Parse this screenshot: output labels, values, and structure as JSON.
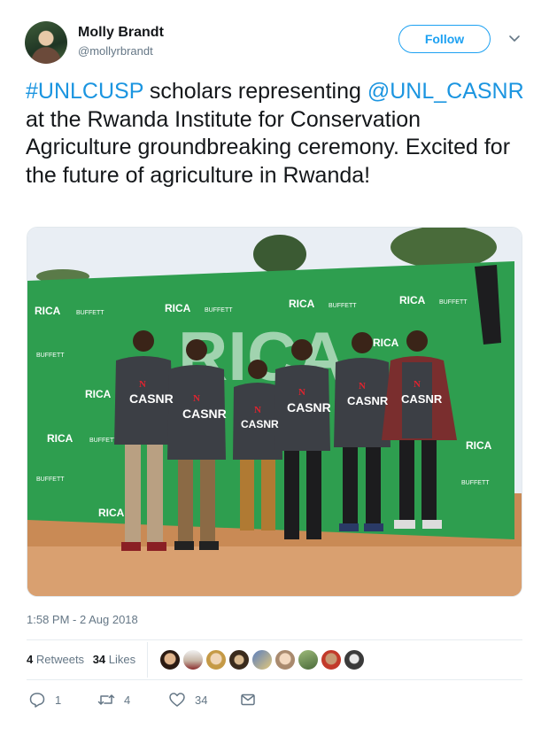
{
  "user": {
    "name": "Molly Brandt",
    "handle": "@mollyrbrandt",
    "follow_label": "Follow"
  },
  "tweet": {
    "hashtag": "#UNLCUSP",
    "text_part1": " scholars representing ",
    "mention": "@UNL_CASNR",
    "text_part2": " at the Rwanda Institute for Conservation Agriculture groundbreaking ceremony. Excited for the future of agriculture in Rwanda!",
    "timestamp": "1:58 PM - 2 Aug 2018"
  },
  "photo": {
    "backdrop_text": "RICA",
    "backdrop_logo": "BUFFETT",
    "shirt_text": "CASNR",
    "shirt_letter": "N"
  },
  "stats": {
    "retweets_count": "4",
    "retweets_label": "Retweets",
    "likes_count": "34",
    "likes_label": "Likes"
  },
  "actions": {
    "replies": "1",
    "retweets": "4",
    "likes": "34"
  },
  "colors": {
    "link": "#1b95e0",
    "follow": "#1da1f2",
    "secondary_text": "#657786",
    "backdrop_green": "#2e9e4f"
  }
}
